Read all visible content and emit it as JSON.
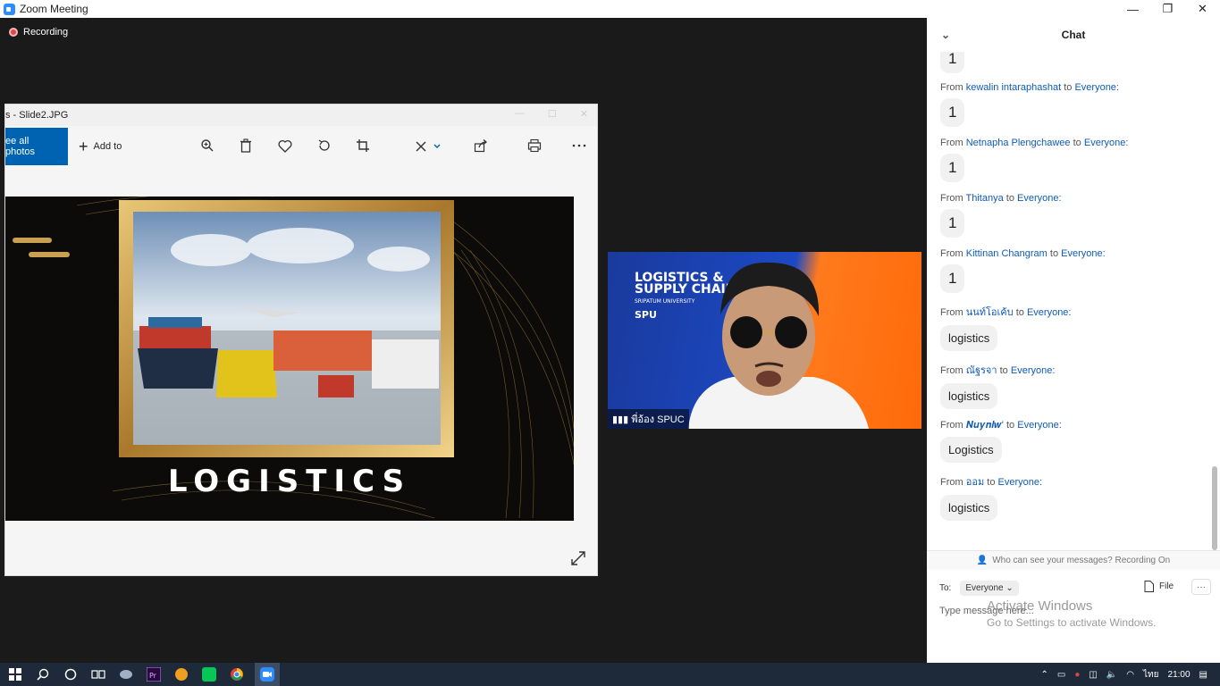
{
  "window": {
    "title": "Zoom Meeting",
    "controls": [
      "—",
      "❐",
      "✕"
    ]
  },
  "recording": {
    "label": "Recording"
  },
  "photos_app": {
    "title": "s - Slide2.JPG",
    "see_all": "ee all photos",
    "add_to": "Add to",
    "slide_text": "LOGISTICS"
  },
  "video": {
    "participant": "พี่อ้อง SPUC",
    "banner_line1": "LOGISTICS &",
    "banner_line2": "SUPPLY CHAIN",
    "banner_line3": "SRIPATUM UNIVERSITY",
    "banner_spu": "SPU"
  },
  "chat": {
    "title": "Chat",
    "prefix": "From",
    "to_word": "to",
    "everyone": "Everyone:",
    "first_bubble": "1",
    "messages": [
      {
        "from": "kewalin intaraphashat",
        "text": "1"
      },
      {
        "from": "Netnapha Plengchawee",
        "text": "1"
      },
      {
        "from": "Thitanya",
        "text": "1"
      },
      {
        "from": "Kittinan Changram",
        "text": "1"
      },
      {
        "from": "นนท์โอเค้บ",
        "text": "logistics"
      },
      {
        "from": "ณัฐรจา",
        "text": "logistics"
      },
      {
        "from": "𝑵𝒖𝒚𝒏𝒍𝒘'",
        "text": "Logistics"
      },
      {
        "from": "ออม",
        "text": "logistics"
      }
    ],
    "privacy": "Who can see your messages? Recording On",
    "to_label": "To:",
    "to_value": "Everyone",
    "file_label": "File",
    "more": "···",
    "placeholder": "Type message here..."
  },
  "watermark": {
    "line1": "Activate Windows",
    "line2": "Go to Settings to activate Windows."
  },
  "taskbar": {
    "lang": "ไทย",
    "time": "21:00"
  }
}
